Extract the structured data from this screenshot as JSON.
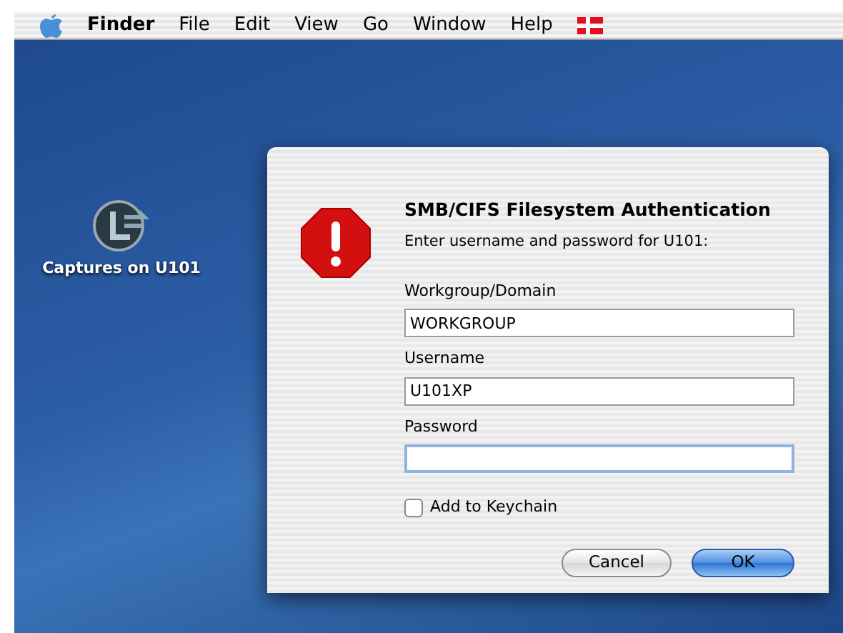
{
  "menu_bar": {
    "items": [
      {
        "label": "Finder",
        "bold": true
      },
      {
        "label": "File",
        "bold": false
      },
      {
        "label": "Edit",
        "bold": false
      },
      {
        "label": "View",
        "bold": false
      },
      {
        "label": "Go",
        "bold": false
      },
      {
        "label": "Window",
        "bold": false
      },
      {
        "label": "Help",
        "bold": false
      }
    ]
  },
  "desktop": {
    "icons": [
      {
        "label": "Captures on U101"
      }
    ]
  },
  "dialog": {
    "title": "SMB/CIFS Filesystem Authentication",
    "message": "Enter username and password for U101:",
    "fields": [
      {
        "label": "Workgroup/Domain",
        "value": "WORKGROUP",
        "focused": false
      },
      {
        "label": "Username",
        "value": "U101XP",
        "focused": false
      },
      {
        "label": "Password",
        "focused": true
      }
    ],
    "checkbox": {
      "label": "Add to Keychain",
      "checked": false
    },
    "buttons": [
      {
        "label": "Cancel",
        "default": false
      },
      {
        "label": "OK",
        "default": true
      }
    ]
  }
}
